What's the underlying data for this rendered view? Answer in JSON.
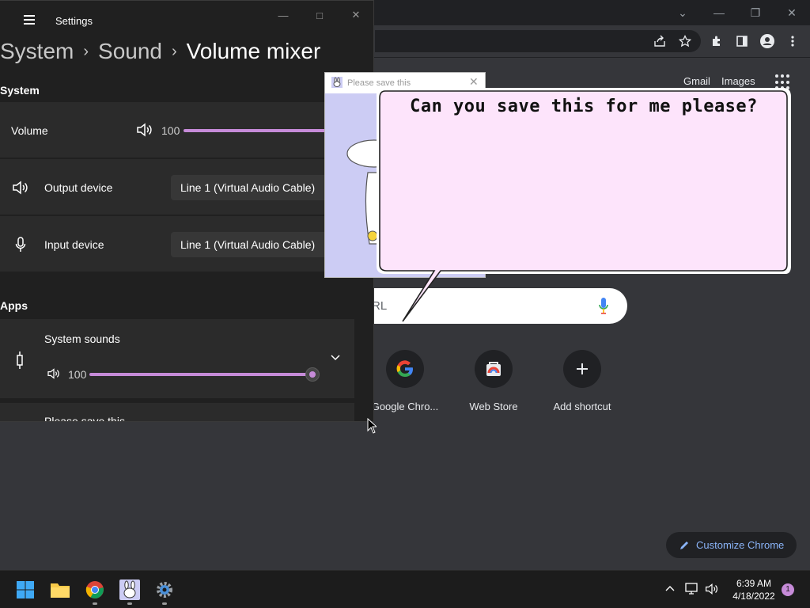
{
  "chrome": {
    "links": {
      "gmail": "Gmail",
      "images": "Images"
    },
    "search_placeholder": "RL",
    "shortcuts": [
      {
        "label": "Google Chro...",
        "icon": "google-icon"
      },
      {
        "label": "Web Store",
        "icon": "web-store-icon"
      },
      {
        "label": "Add shortcut",
        "icon": "plus-icon"
      }
    ],
    "customize_label": "Customize Chrome"
  },
  "settings": {
    "window_title": "Settings",
    "breadcrumb": {
      "first": "System",
      "second": "Sound",
      "current": "Volume mixer"
    },
    "system_section": {
      "heading": "System",
      "volume_label": "Volume",
      "volume_value": "100",
      "volume_level": 1.0,
      "output_label": "Output device",
      "output_value": "Line 1 (Virtual Audio Cable)",
      "input_label": "Input device",
      "input_value": "Line 1 (Virtual Audio Cable)"
    },
    "apps_section": {
      "heading": "Apps",
      "system_sounds_label": "System sounds",
      "system_sounds_value": "100",
      "system_sounds_level": 1.0,
      "next_app_label": "Please save this"
    }
  },
  "popup": {
    "title": "Please save this",
    "bubble_text": "Can you save this for me please?"
  },
  "taskbar": {
    "time": "6:39 AM",
    "date": "4/18/2022",
    "notification_count": "1"
  },
  "colors": {
    "accent": "#c68bd8",
    "bubble_fill": "#fde4fb"
  }
}
